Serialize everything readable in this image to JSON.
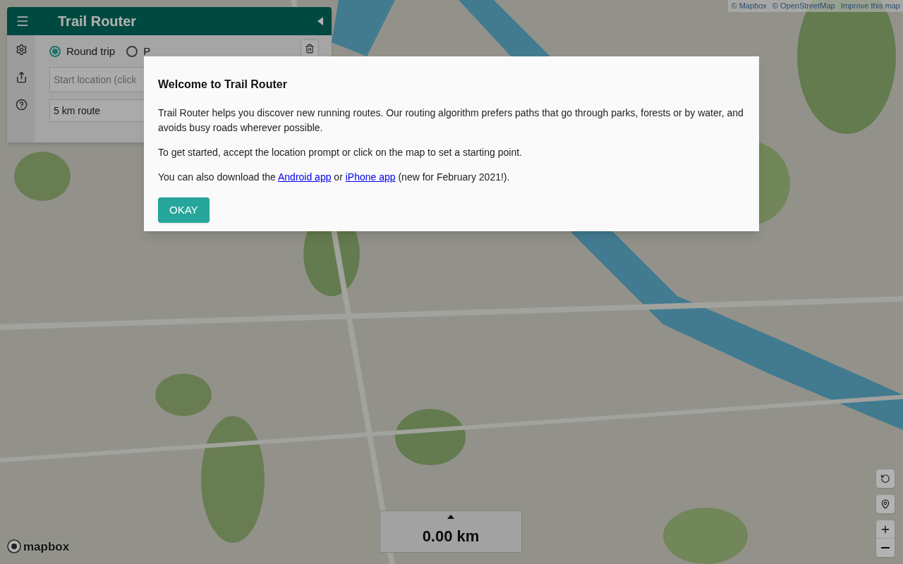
{
  "attribution": {
    "links": [
      {
        "prefix": "©",
        "label": "Mapbox"
      },
      {
        "prefix": "©",
        "label": "OpenStreetMap"
      },
      {
        "label": "Improve this map"
      }
    ]
  },
  "sidebar": {
    "title": "Trail Router",
    "route_types": [
      {
        "label": "Round trip",
        "selected": true
      },
      {
        "label": "P",
        "selected": false
      }
    ],
    "start_field": {
      "placeholder": "Start location (click"
    },
    "distance_field": {
      "value": "5 km route"
    }
  },
  "distance_panel": {
    "reading": "0.00 km"
  },
  "map_logo": "mapbox",
  "dialog": {
    "title": "Welcome to Trail Router",
    "paragraphs": [
      [
        {
          "kind": "text",
          "text": "Trail Router helps you discover new running routes. Our routing algorithm prefers paths that go through parks, forests or by water, and avoids busy roads wherever possible."
        }
      ],
      [
        {
          "kind": "text",
          "text": "To get started, accept the location prompt or click on the map to set a starting point."
        }
      ],
      [
        {
          "kind": "text",
          "text": "You can also download the "
        },
        {
          "kind": "link",
          "text": "Android app"
        },
        {
          "kind": "text",
          "text": " or "
        },
        {
          "kind": "link",
          "text": "iPhone app"
        },
        {
          "kind": "text",
          "text": " (new for February 2021!)."
        }
      ]
    ],
    "button": "OKAY"
  }
}
